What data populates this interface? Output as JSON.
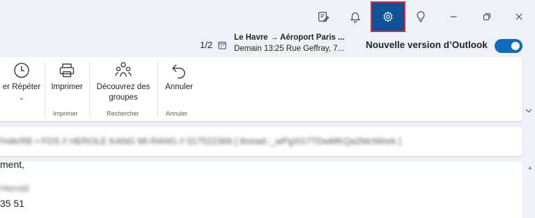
{
  "titlebar": {
    "buttons": [
      {
        "name": "compose-note-button",
        "icon": "note-pen-icon"
      },
      {
        "name": "notifications-button",
        "icon": "bell-icon"
      },
      {
        "name": "settings-button",
        "icon": "gear-icon"
      },
      {
        "name": "tips-button",
        "icon": "lightbulb-icon"
      },
      {
        "name": "minimize-button",
        "icon": "minimize-icon"
      },
      {
        "name": "restore-button",
        "icon": "restore-icon"
      },
      {
        "name": "close-button",
        "icon": "close-icon"
      }
    ],
    "active_color": "#0f5196",
    "highlight_color": "#e0263a"
  },
  "subbar": {
    "pager": "1/2",
    "event_title": "Le Havre → Aéroport Paris ...",
    "event_subtitle": "Demain 13:25 Rue Geffray, 7...",
    "new_version_label": "Nouvelle version d’Outlook",
    "toggle_on": true,
    "toggle_color": "#0f6cbd"
  },
  "ribbon": {
    "items": [
      {
        "label": "er Répéter",
        "icon": "clock-icon"
      },
      {
        "label": "Imprimer",
        "icon": "printer-icon"
      },
      {
        "label": "Découvrez des groupes",
        "label_line1": "Découvrez des",
        "label_line2": "groupes",
        "icon": "people-group-icon"
      },
      {
        "label": "Annuler",
        "icon": "undo-icon"
      }
    ],
    "groups": [
      "Imprimer",
      "Rechercher",
      "Annuler"
    ]
  },
  "message": {
    "subject": "FHAVRE • FDS // HEROLE KANG MI-RANG // 017522366 [ thread::_wPgXG7TDwMKQa2McIWork ]",
    "body_lines": [
      "ment,",
      "Herold",
      "35 51"
    ]
  }
}
